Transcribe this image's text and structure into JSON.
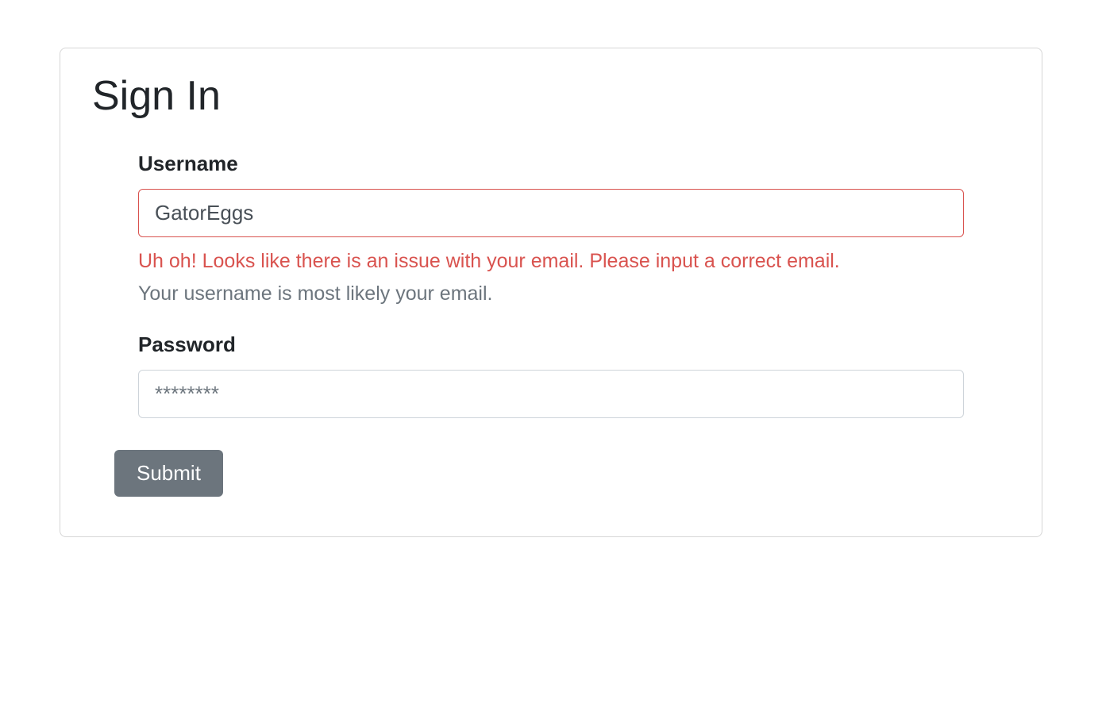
{
  "form": {
    "title": "Sign In",
    "username": {
      "label": "Username",
      "value": "GatorEggs",
      "error": "Uh oh! Looks like there is an issue with your email. Please input a correct email.",
      "hint": "Your username is most likely your email."
    },
    "password": {
      "label": "Password",
      "placeholder": "********",
      "value": ""
    },
    "submit_label": "Submit"
  }
}
